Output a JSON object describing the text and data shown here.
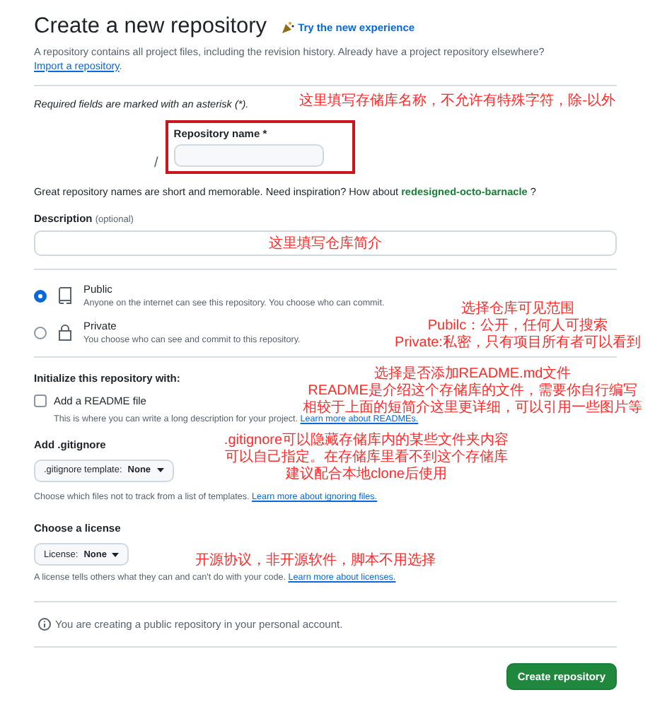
{
  "header": {
    "title": "Create a new repository",
    "try_link": "Try the new experience",
    "intro": "A repository contains all project files, including the revision history. Already have a project repository elsewhere?",
    "import_link": "Import a repository",
    "import_tail": "."
  },
  "required_note": "Required fields are marked with an asterisk (*).",
  "name_field": {
    "label": "Repository name *",
    "separator": "/",
    "highlighted": true,
    "note": [
      "这里填写存储库名称，不允许有特殊字符，除-以外"
    ]
  },
  "suggestion": {
    "text": "Great repository names are short and memorable. Need inspiration? How about",
    "name": "redesigned-octo-barnacle",
    "tail": "?"
  },
  "description": {
    "label": "Description",
    "optional": "(optional)",
    "note": [
      "这里填写仓库简介"
    ]
  },
  "visibility": {
    "options": [
      {
        "kind": "public",
        "label": "Public",
        "hint": "Anyone on the internet can see this repository. You choose who can commit.",
        "selected": true
      },
      {
        "kind": "private",
        "label": "Private",
        "hint": "You choose who can see and commit to this repository.",
        "selected": false
      }
    ],
    "note": [
      "选择仓库可见范围",
      "Pubilc：公开，任何人可搜索",
      "Private:私密，只有项目所有者可以看到"
    ]
  },
  "initialize": {
    "title": "Initialize this repository with:",
    "checkbox": {
      "label": "Add a README file",
      "checked": false
    },
    "hint": "This is where you can write a long description for your project.",
    "link": "Learn more about READMEs.",
    "note": [
      "选择是否添加README.md文件",
      "README是介绍这个存储库的文件，需要你自行编写",
      "相较于上面的短简介这里更详细，可以引用一些图片等"
    ]
  },
  "gitignore": {
    "title": "Add .gitignore",
    "dropdown": {
      "prefix": ".gitignore template:",
      "value": "None"
    },
    "hint": "Choose which files not to track from a list of templates.",
    "link": "Learn more about ignoring files.",
    "note": [
      ".gitignore可以隐藏存储库内的某些文件夹内容",
      "可以自己指定。在存储库里看不到这个存储库",
      "建议配合本地clone后使用"
    ]
  },
  "license": {
    "title": "Choose a license",
    "dropdown": {
      "prefix": "License:",
      "value": "None"
    },
    "hint": "A license tells others what they can and can't do with your code.",
    "link": "Learn more about licenses.",
    "note": [
      "开源协议，非开源软件，脚本不用选择"
    ]
  },
  "info": "You are creating a public repository in your personal account.",
  "submit": "Create repository"
}
